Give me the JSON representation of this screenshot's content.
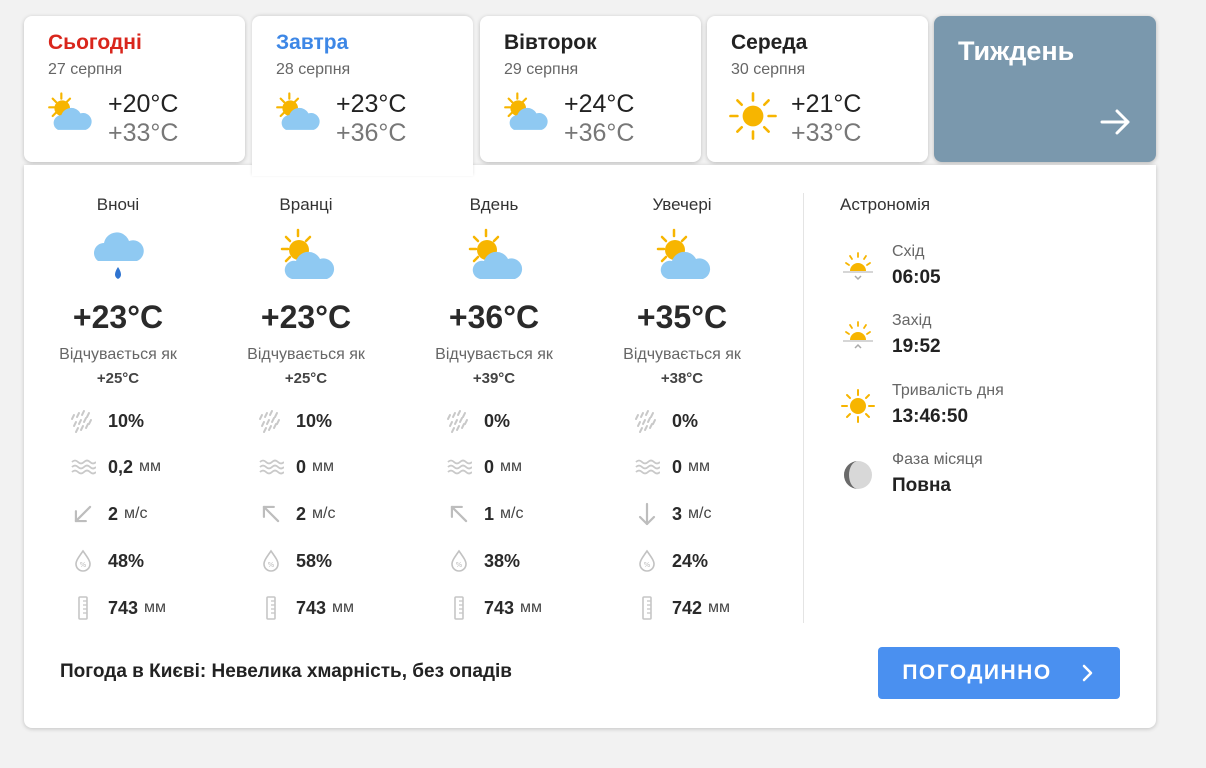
{
  "tabs": [
    {
      "day": "Сьогодні",
      "date": "27 серпня",
      "tmin": "+20°C",
      "tmax": "+33°C",
      "icon": "sun-cloud-icon",
      "color": "#d9261c"
    },
    {
      "day": "Завтра",
      "date": "28 серпня",
      "tmin": "+23°C",
      "tmax": "+36°C",
      "icon": "sun-cloud-icon",
      "color": "#3d87e6"
    },
    {
      "day": "Вівторок",
      "date": "29 серпня",
      "tmin": "+24°C",
      "tmax": "+36°C",
      "icon": "sun-cloud-icon",
      "color": "#222222"
    },
    {
      "day": "Середа",
      "date": "30 серпня",
      "tmin": "+21°C",
      "tmax": "+33°C",
      "icon": "sun-icon",
      "color": "#222222"
    }
  ],
  "week": {
    "label": "Тиждень",
    "icon": "arrow-right-icon"
  },
  "feels_label": "Відчувається як",
  "periods": [
    {
      "name": "Вночі",
      "icon": "rain-cloud-icon",
      "temp": "+23°C",
      "feels": "+25°C",
      "precip_prob": "10%",
      "precip": "0,2",
      "precip_unit": "мм",
      "wind": "2",
      "wind_unit": "м/с",
      "wind_dir": "south-west",
      "humidity": "48%",
      "pressure": "743",
      "pressure_unit": "мм"
    },
    {
      "name": "Вранці",
      "icon": "sun-cloud-icon",
      "temp": "+23°C",
      "feels": "+25°C",
      "precip_prob": "10%",
      "precip": "0",
      "precip_unit": "мм",
      "wind": "2",
      "wind_unit": "м/с",
      "wind_dir": "north-west",
      "humidity": "58%",
      "pressure": "743",
      "pressure_unit": "мм"
    },
    {
      "name": "Вдень",
      "icon": "sun-cloud-icon",
      "temp": "+36°C",
      "feels": "+39°C",
      "precip_prob": "0%",
      "precip": "0",
      "precip_unit": "мм",
      "wind": "1",
      "wind_unit": "м/с",
      "wind_dir": "north-west",
      "humidity": "38%",
      "pressure": "743",
      "pressure_unit": "мм"
    },
    {
      "name": "Увечері",
      "icon": "sun-cloud-icon",
      "temp": "+35°C",
      "feels": "+38°C",
      "precip_prob": "0%",
      "precip": "0",
      "precip_unit": "мм",
      "wind": "3",
      "wind_unit": "м/с",
      "wind_dir": "south",
      "humidity": "24%",
      "pressure": "742",
      "pressure_unit": "мм"
    }
  ],
  "astronomy": {
    "title": "Астрономія",
    "items": [
      {
        "label": "Схід",
        "value": "06:05",
        "icon": "sunrise-icon"
      },
      {
        "label": "Захід",
        "value": "19:52",
        "icon": "sunset-icon"
      },
      {
        "label": "Тривалість дня",
        "value": "13:46:50",
        "icon": "sun-icon"
      },
      {
        "label": "Фаза місяця",
        "value": "Повна",
        "icon": "moon-phase-icon"
      }
    ]
  },
  "summary": "Погода в Києві: Невелика хмарність, без опадів",
  "hourly_button": {
    "label": "ПОГОДИННО",
    "icon": "chevron-right-icon"
  },
  "colors": {
    "accent": "#4a90f0",
    "week_bg": "#7a98ad",
    "sun": "#f7b500",
    "cloud": "#8fc9f2"
  }
}
